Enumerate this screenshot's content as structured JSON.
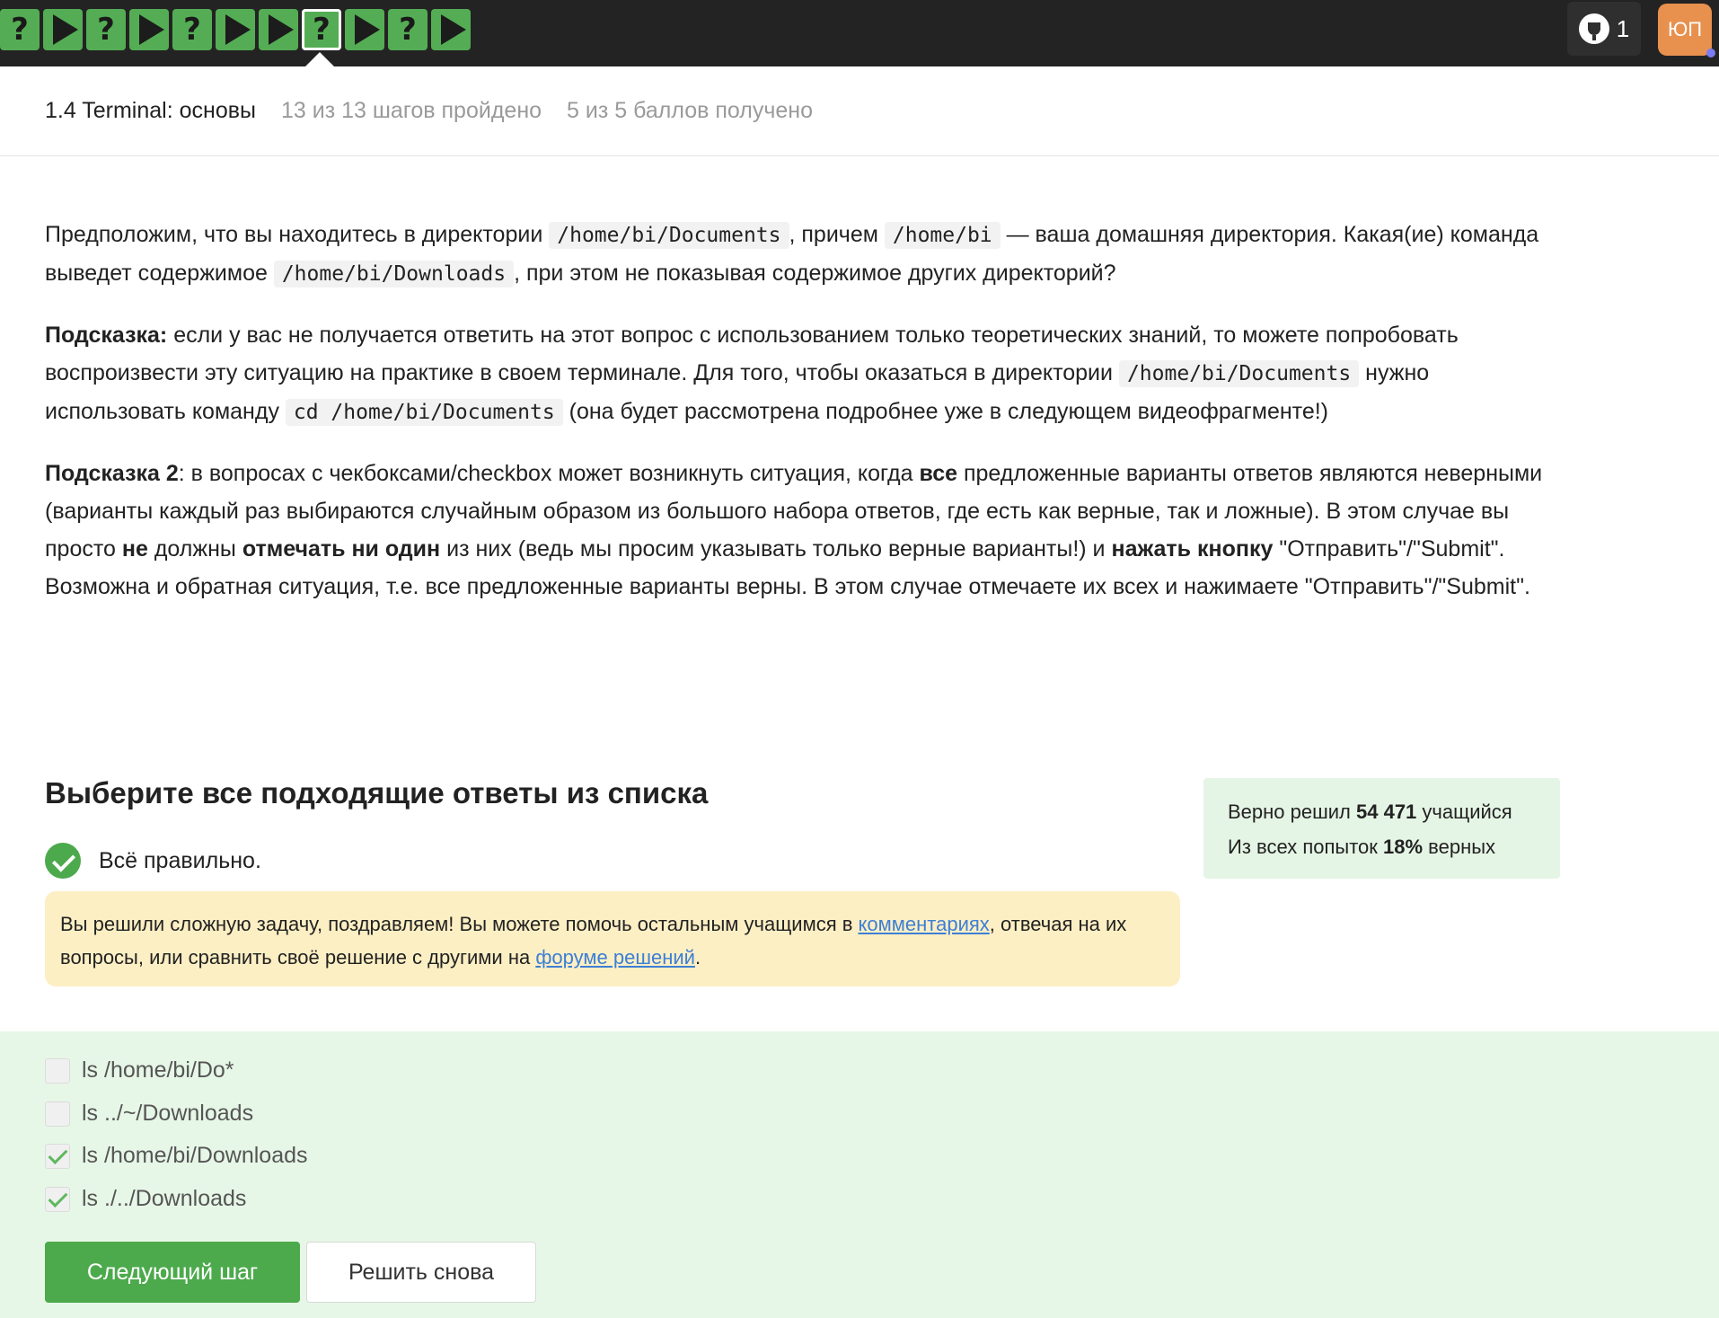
{
  "topbar": {
    "steps": [
      {
        "type": "question",
        "label": "?"
      },
      {
        "type": "video",
        "label": ""
      },
      {
        "type": "question",
        "label": "?"
      },
      {
        "type": "video",
        "label": ""
      },
      {
        "type": "question",
        "label": "?"
      },
      {
        "type": "video",
        "label": ""
      },
      {
        "type": "video",
        "label": ""
      },
      {
        "type": "question",
        "label": "?",
        "current": true
      },
      {
        "type": "video",
        "label": ""
      },
      {
        "type": "question",
        "label": "?"
      },
      {
        "type": "video",
        "label": ""
      }
    ],
    "achievements_count": "1",
    "avatar_initials": "ЮП",
    "step_color": "#54ad54",
    "avatar_color": "#e8914e"
  },
  "lesson": {
    "title": "1.4 Terminal: основы",
    "progress": "13 из 13 шагов пройдено",
    "score": "5 из 5 баллов  получено"
  },
  "body": {
    "p1_a": "Предположим, что вы находитесь в директории ",
    "p1_code1": "/home/bi/Documents",
    "p1_b": ", причем ",
    "p1_code2": "/home/bi",
    "p1_c": " — ваша домашняя директория. Какая(ие) команда выведет содержимое ",
    "p1_code3": "/home/bi/Downloads",
    "p1_d": ", при этом не показывая содержимое других директорий?",
    "hint1_label": "Подсказка:",
    "hint1_a": " если у вас не получается ответить на этот вопрос с использованием только теоретических знаний, то можете попробовать воспроизвести эту ситуацию на практике в своем терминале. Для того, чтобы оказаться в директории ",
    "hint1_code1": "/home/bi/Documents",
    "hint1_b": " нужно использовать команду ",
    "hint1_code2": "cd /home/bi/Documents",
    "hint1_c": " (она будет рассмотрена подробнее уже в следующем видеофрагменте!)",
    "hint2_label": "Подсказка 2",
    "hint2_a": ": в вопросах с чекбоксами/checkbox может возникнуть ситуация, когда ",
    "hint2_b1": "все",
    "hint2_c": " предложенные варианты ответов являются неверными (варианты каждый раз выбираются случайным образом из большого набора ответов, где есть как верные, так и ложные). В этом случае вы просто ",
    "hint2_b2": "не",
    "hint2_d": " должны ",
    "hint2_b3": "отмечать ни один",
    "hint2_e": " из них (ведь мы просим указывать только верные варианты!) и ",
    "hint2_b4": "нажать кнопку",
    "hint2_f": " \"Отправить\"/\"Submit\". Возможна и обратная ситуация, т.е. все предложенные варианты верны. В этом случае отмечаете их всех и нажимаете \"Отправить\"/\"Submit\"."
  },
  "quiz": {
    "title": "Выберите все подходящие ответы из списка",
    "correct_text": "Всё правильно.",
    "congrats_a": "Вы решили сложную задачу, поздравляем! Вы можете помочь остальным учащимся в ",
    "congrats_link1": "комментариях",
    "congrats_b": ", отвечая на их вопросы, или сравнить своё решение с другими на ",
    "congrats_link2": "форуме решений",
    "congrats_c": ".",
    "options": [
      {
        "label": "ls /home/bi/Do*",
        "checked": false
      },
      {
        "label": "ls ../~/Downloads",
        "checked": false
      },
      {
        "label": "ls /home/bi/Downloads",
        "checked": true
      },
      {
        "label": "ls ./../Downloads",
        "checked": true
      }
    ],
    "next_button": "Следующий шаг",
    "retry_button": "Решить снова"
  },
  "stats": {
    "line1_a": "Верно решил ",
    "line1_num": "54 471",
    "line1_b": " учащийся",
    "line2_a": "Из всех попыток ",
    "line2_num": "18%",
    "line2_b": " верных"
  }
}
